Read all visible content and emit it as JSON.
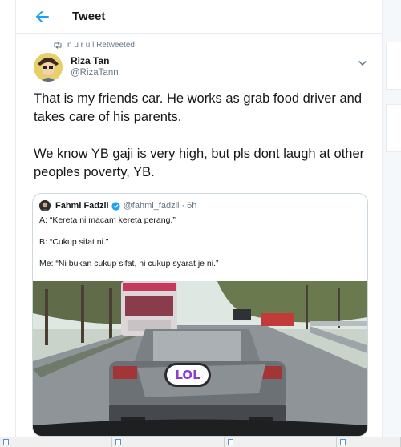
{
  "header": {
    "title": "Tweet",
    "back_icon": "back-arrow-icon"
  },
  "retweet": {
    "text": "n u r u l Retweeted",
    "icon": "retweet-icon"
  },
  "author": {
    "name": "Riza Tan",
    "handle": "@RizaTann"
  },
  "tweet": {
    "paragraph1": "That is my friends car. He works as grab food driver and takes care of his parents.",
    "paragraph2": "We know YB gaji is very high, but pls dont laugh at other peoples poverty, YB."
  },
  "quote": {
    "name": "Fahmi Fadzil",
    "handle": "@fahmi_fadzil",
    "dot": "·",
    "time": "6h",
    "lines": [
      "A: “Kereta ni macam kereta perang.”",
      "B: “Cukup sifat ni.”",
      "Me: “Ni bukan cukup sifat, ni cukup syarat je ni.”"
    ],
    "sticker_text": "LOL"
  },
  "taskbar": {
    "items": [
      "",
      "",
      "",
      ""
    ]
  },
  "colors": {
    "accent": "#1da1f2",
    "text": "#14171a",
    "muted": "#657786",
    "border": "#e6ecf0"
  }
}
